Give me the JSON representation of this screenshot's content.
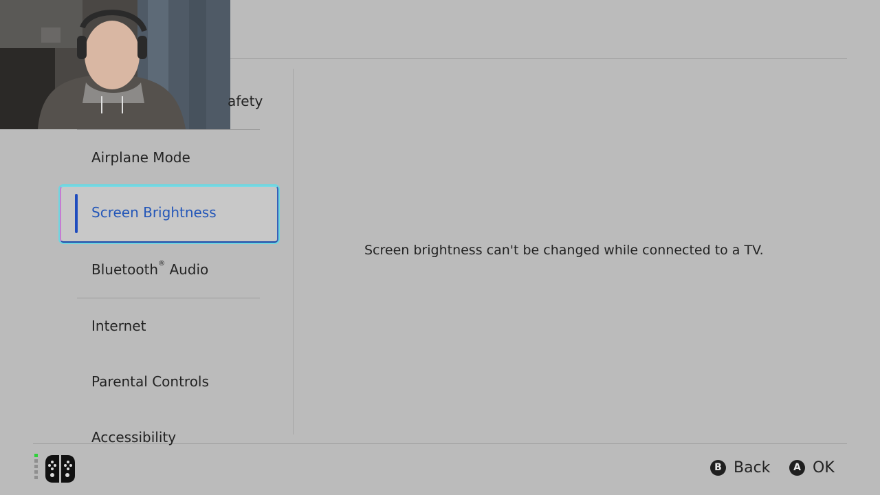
{
  "menu": {
    "partial_item": "afety",
    "items": [
      {
        "label": "Airplane Mode"
      },
      {
        "label": "Screen Brightness"
      },
      {
        "label": "Bluetooth",
        "trademark": "®",
        "label_suffix": " Audio"
      },
      {
        "label": "Internet"
      },
      {
        "label": "Parental Controls"
      },
      {
        "label": "Accessibility"
      }
    ],
    "selected_index": 1
  },
  "content": {
    "message": "Screen brightness can't be changed while connected to a TV."
  },
  "footer": {
    "back": {
      "key": "B",
      "label": "Back"
    },
    "ok": {
      "key": "A",
      "label": "OK"
    }
  },
  "colors": {
    "background": "#bbbbbb",
    "selected_text": "#2356b8",
    "selected_bar": "#1f4cbe"
  }
}
